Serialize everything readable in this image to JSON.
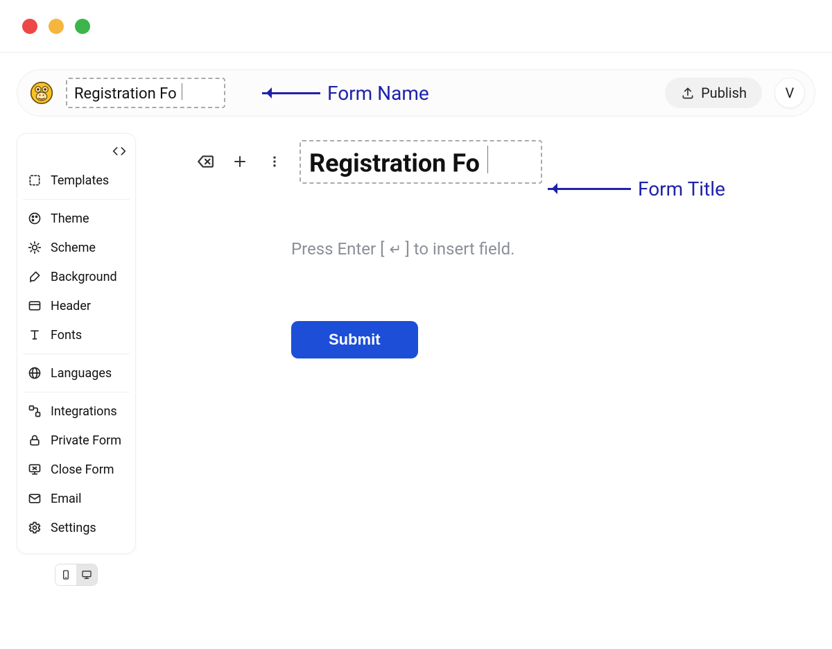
{
  "header": {
    "form_name": "Registration Fo",
    "publish_label": "Publish",
    "avatar_initial": "V"
  },
  "annotations": {
    "form_name_label": "Form Name",
    "form_title_label": "Form Title"
  },
  "sidebar": {
    "items": [
      {
        "label": "Templates"
      },
      {
        "label": "Theme"
      },
      {
        "label": "Scheme"
      },
      {
        "label": "Background"
      },
      {
        "label": "Header"
      },
      {
        "label": "Fonts"
      },
      {
        "label": "Languages"
      },
      {
        "label": "Integrations"
      },
      {
        "label": "Private Form"
      },
      {
        "label": "Close Form"
      },
      {
        "label": "Email"
      },
      {
        "label": "Settings"
      }
    ]
  },
  "canvas": {
    "form_title": "Registration Fo",
    "hint_prefix": "Press Enter [",
    "hint_suffix": "] to insert field.",
    "submit_label": "Submit"
  }
}
